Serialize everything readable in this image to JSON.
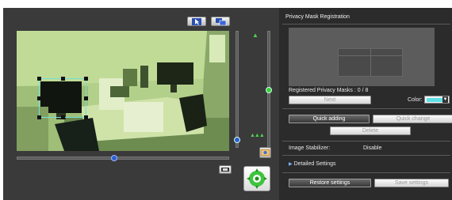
{
  "right_panel": {
    "title": "Privacy Mask Registration",
    "registered_label": "Registered Privacy Masks : 0 / 8",
    "next_label": "Next",
    "color_label": "Color:",
    "color_value": "#5ee0e6",
    "color_dropdown_icon": "chevron-down-icon",
    "quick_adding_label": "Quick adding",
    "quick_change_label": "Quick change",
    "delete_label": "Delete",
    "stabilizer_label": "Image Stabilizer:",
    "stabilizer_value": "Disable",
    "detailed_settings_label": "Detailed Settings",
    "detailed_settings_icon": "triangle-right-icon",
    "restore_label": "Restore settings",
    "save_label": "Save settings"
  },
  "left_panel": {
    "toolbar_icons": [
      "cursor-icon",
      "screen-swap-icon"
    ],
    "zoom_icons": [
      "zoom-tele-icon",
      "zoom-wide-icon"
    ],
    "side_icons": [
      "snapshot-icon",
      "display-toggle-icon",
      "ptz-center-icon"
    ],
    "horizontal_slider_value": 0.45,
    "zoom_slider_value": 0.5,
    "focus_slider_value": 0.95
  },
  "colors": {
    "accent_mask": "#6fe0d8",
    "slider_green": "#3bd13b",
    "slider_blue": "#2f5fd0"
  }
}
